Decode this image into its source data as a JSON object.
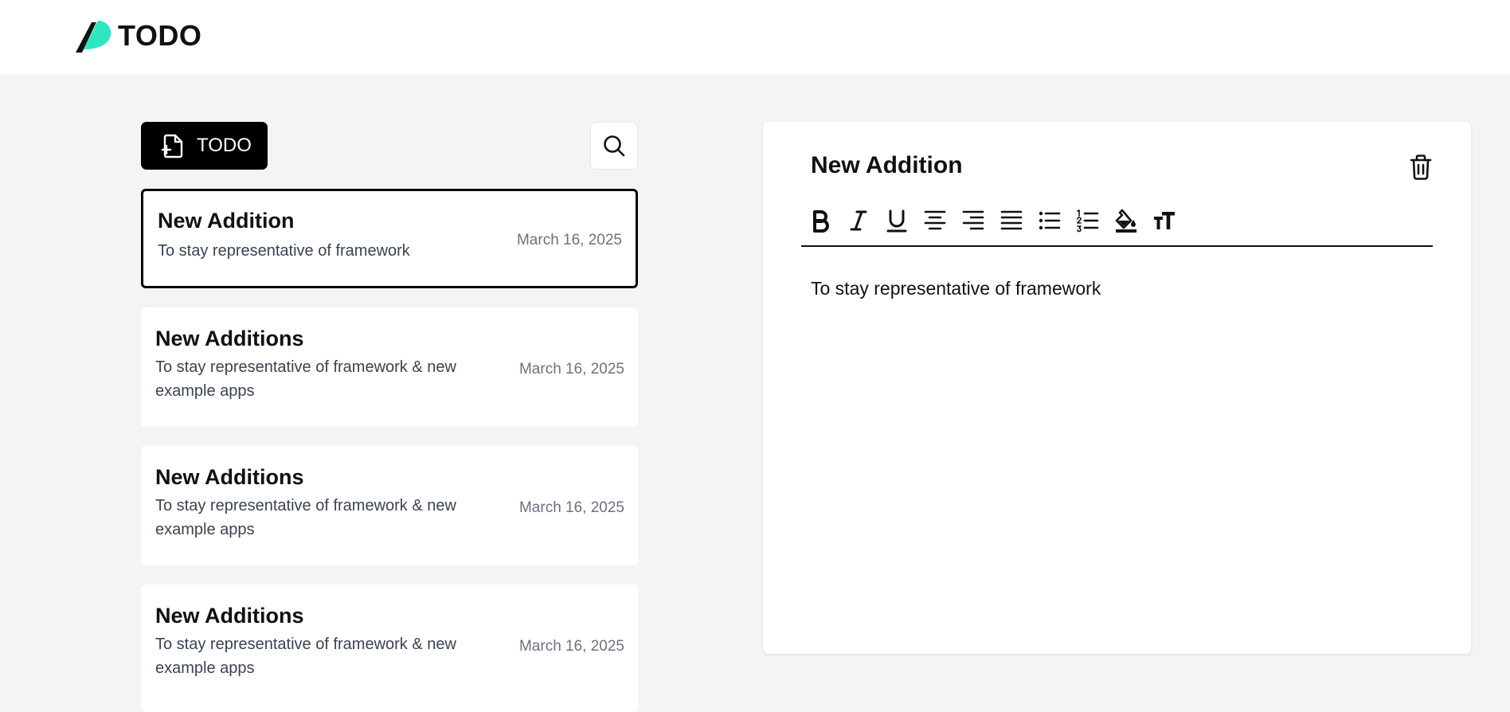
{
  "header": {
    "app_name": "TODO",
    "colors": {
      "logo_accent": "#2ee6c0",
      "logo_shadow": "#111111"
    }
  },
  "sidebar": {
    "new_button": {
      "label": "TODO",
      "icon": "file-plus-icon"
    },
    "search_button": {
      "icon": "search-icon"
    },
    "notes": [
      {
        "title": "New Addition",
        "excerpt": "To stay representative of framework",
        "date": "March 16, 2025",
        "selected": true
      },
      {
        "title": "New Additions",
        "excerpt": "To stay representative of framework & new example apps",
        "date": "March 16, 2025",
        "selected": false
      },
      {
        "title": "New Additions",
        "excerpt": "To stay representative of framework & new example apps",
        "date": "March 16, 2025",
        "selected": false
      },
      {
        "title": "New Additions",
        "excerpt": "To stay representative of framework & new example apps",
        "date": "March 16, 2025",
        "selected": false
      }
    ]
  },
  "editor": {
    "title": "New Addition",
    "body": "To stay representative of framework",
    "delete_icon": "trash-icon",
    "toolbar": [
      "bold-icon",
      "italic-icon",
      "underline-icon",
      "align-center-icon",
      "align-right-icon",
      "align-justify-icon",
      "bullet-list-icon",
      "numbered-list-icon",
      "fill-color-icon",
      "text-size-icon"
    ]
  }
}
